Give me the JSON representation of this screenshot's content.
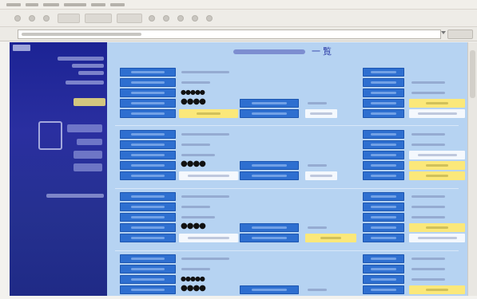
{
  "browser": {
    "menu_count": 6,
    "toolbar_buttons": [
      "back-button",
      "forward-button",
      "stop-button",
      "refresh-button",
      "home-button",
      "search-button",
      "favorites-button",
      "history-button",
      "mail-button",
      "print-button",
      "edit-button"
    ]
  },
  "page": {
    "title_suffix": "一覧"
  },
  "records": [
    {
      "rating": "●●●●",
      "sub": "●●●●●"
    },
    {
      "rating": "●●●●",
      "sub": ""
    },
    {
      "rating": "●●●●",
      "sub": ""
    },
    {
      "rating": "●●●●",
      "sub": "●●●●●"
    }
  ],
  "colors": {
    "sidebar": "#1c2394",
    "main_bg": "#b6d3f2",
    "label_cell": "#2e6fd0",
    "highlight": "#fbe87a"
  }
}
